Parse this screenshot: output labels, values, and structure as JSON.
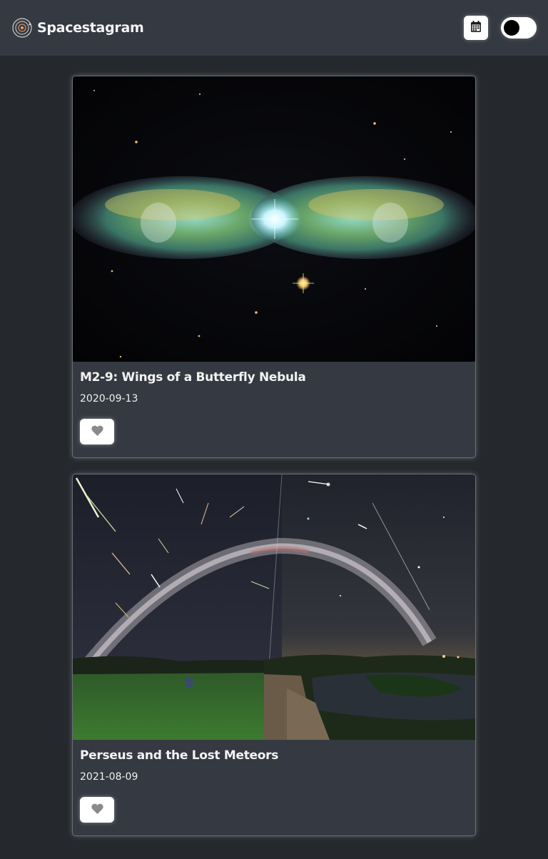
{
  "app": {
    "title": "Spacestagram",
    "logo_icon": "orbit-logo-icon"
  },
  "header": {
    "calendar_icon": "calendar-icon",
    "theme_toggle_state": "dark"
  },
  "posts": [
    {
      "title": "M2-9: Wings of a Butterfly Nebula",
      "date": "2020-09-13",
      "like_icon": "heart-icon"
    },
    {
      "title": "Perseus and the Lost Meteors",
      "date": "2021-08-09",
      "like_icon": "heart-icon"
    }
  ]
}
